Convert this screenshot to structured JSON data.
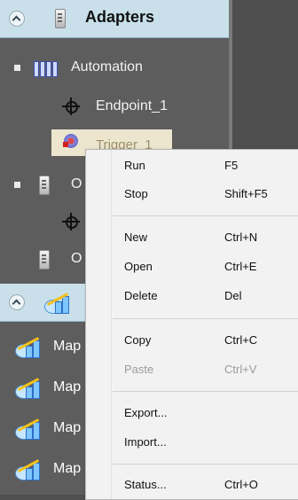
{
  "adapters_panel": {
    "title": "Adapters",
    "tree": {
      "automation_label": "Automation",
      "endpoint_label": "Endpoint_1",
      "trigger_label": "Trigger_1",
      "group2_label": "O",
      "group3_label": "O"
    }
  },
  "maps_panel": {
    "items": [
      "Map",
      "Map",
      "Map",
      "Map"
    ]
  },
  "context_menu": {
    "items": [
      {
        "label": "Run",
        "shortcut": "F5"
      },
      {
        "label": "Stop",
        "shortcut": "Shift+F5"
      },
      {
        "label": "New",
        "shortcut": "Ctrl+N"
      },
      {
        "label": "Open",
        "shortcut": "Ctrl+E"
      },
      {
        "label": "Delete",
        "shortcut": "Del"
      },
      {
        "label": "Copy",
        "shortcut": "Ctrl+C"
      },
      {
        "label": "Paste",
        "shortcut": "Ctrl+V",
        "disabled": true
      },
      {
        "label": "Export...",
        "shortcut": ""
      },
      {
        "label": "Import...",
        "shortcut": ""
      },
      {
        "label": "Status...",
        "shortcut": "Ctrl+O"
      }
    ]
  },
  "icons": {
    "adapters_header": "server-icon",
    "automation": "pipes-icon",
    "endpoint": "node-icon",
    "trigger": "gear-icon",
    "maps_header": "map-icon",
    "map_item": "map-icon"
  },
  "colors": {
    "header_bg": "#c9e0ea",
    "sidebar_bg": "#5d5d5d",
    "selection_bg": "#ece6cf",
    "menu_bg": "#f2f2f2"
  }
}
